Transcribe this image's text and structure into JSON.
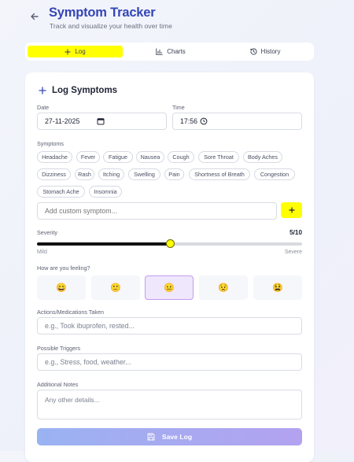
{
  "header": {
    "title": "Symptom Tracker",
    "subtitle": "Track and visualize your health over time"
  },
  "tabs": [
    {
      "label": "Log",
      "active": true,
      "icon": "plus-icon"
    },
    {
      "label": "Charts",
      "active": false,
      "icon": "bar-chart-icon"
    },
    {
      "label": "History",
      "active": false,
      "icon": "history-icon"
    }
  ],
  "form": {
    "title": "Log Symptoms",
    "date_label": "Date",
    "date_value": "27-11-2025",
    "time_label": "Time",
    "time_value": "17:56",
    "symptoms_label": "Symptoms",
    "symptoms": [
      "Headache",
      "Fever",
      "Fatigue",
      "Nausea",
      "Cough",
      "Sore Throat",
      "Body Aches",
      "Dizziness",
      "Rash",
      "Itching",
      "Swelling",
      "Pain",
      "Shortness of Breath",
      "Congestion",
      "Stomach Ache",
      "Insomnia"
    ],
    "custom_placeholder": "Add custom symptom...",
    "add_label": "+",
    "severity_label": "Severity",
    "severity_display": "5/10",
    "severity_value": 5,
    "severity_max": 10,
    "severity_min_label": "Mild",
    "severity_max_label": "Severe",
    "feeling_label": "How are you feeling?",
    "moods": [
      "😄",
      "🙂",
      "😐",
      "😟",
      "😫"
    ],
    "selected_mood": 2,
    "actions_label": "Actions/Medications Taken",
    "actions_placeholder": "e.g., Took ibuprofen, rested...",
    "triggers_label": "Possible Triggers",
    "triggers_placeholder": "e.g., Stress, food, weather...",
    "notes_label": "Additional Notes",
    "notes_placeholder": "Any other details...",
    "save_label": "Save Log"
  },
  "colors": {
    "accent": "#ffff00",
    "title": "#3446b5",
    "selected_mood_border": "#c39cf0"
  }
}
